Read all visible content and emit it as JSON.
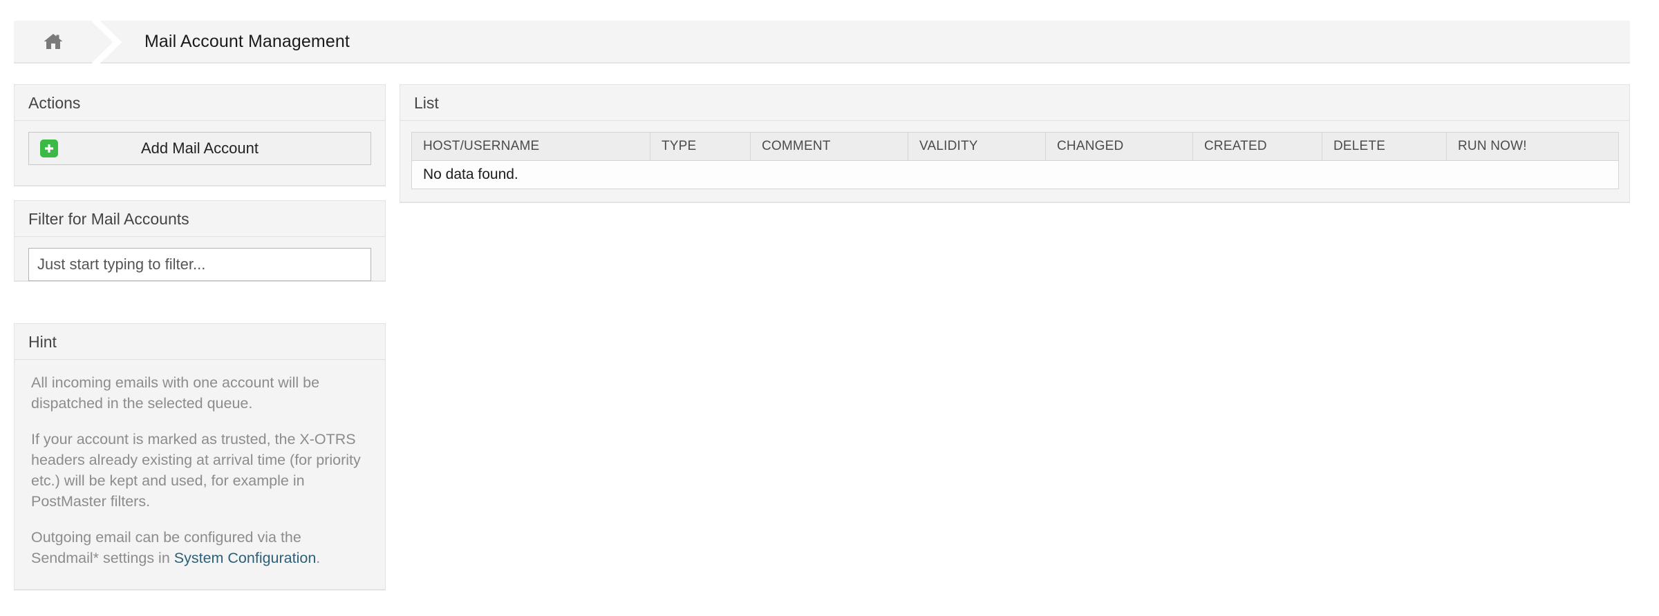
{
  "breadcrumb": {
    "home_icon": "home-icon",
    "separator_icon": "chevron-right-icon",
    "title": "Mail Account Management"
  },
  "sidebar": {
    "actions": {
      "header": "Actions",
      "add_button": {
        "label": "Add Mail Account",
        "icon": "plus-icon",
        "icon_color": "#3aba45"
      }
    },
    "filter": {
      "header": "Filter for Mail Accounts",
      "input_value": "",
      "input_placeholder": "Just start typing to filter..."
    },
    "hint": {
      "header": "Hint",
      "paragraphs": [
        "All incoming emails with one account will be dispatched in the selected queue.",
        "If your account is marked as trusted, the X-OTRS headers already existing at arrival time (for priority etc.) will be kept and used, for example in PostMaster filters."
      ],
      "outgoing_text_before": "Outgoing email can be configured via the Sendmail* settings in ",
      "outgoing_link": "System Configuration",
      "outgoing_text_after": ".",
      "link_color": "#2d5f77"
    }
  },
  "main": {
    "list": {
      "header": "List",
      "columns": [
        "HOST/USERNAME",
        "TYPE",
        "COMMENT",
        "VALIDITY",
        "CHANGED",
        "CREATED",
        "DELETE",
        "RUN NOW!"
      ],
      "empty_message": "No data found.",
      "rows": []
    }
  }
}
